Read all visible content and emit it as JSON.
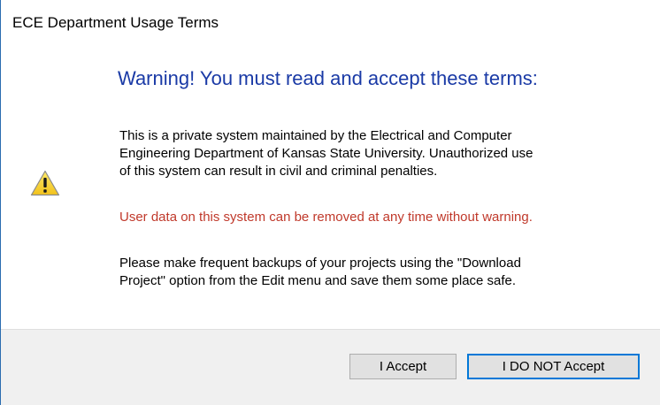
{
  "window": {
    "title": "ECE Department Usage Terms"
  },
  "dialog": {
    "heading": "Warning! You must read and accept these terms:",
    "icon": "warning-icon",
    "paragraph1_lines": [
      "This is a private system maintained by the Electrical and Computer",
      "Engineering Department of Kansas State University. Unauthorized use",
      "of this system can result in civil and criminal penalties."
    ],
    "warning_text": "User data on this system can be removed at any time without warning.",
    "paragraph3_lines": [
      "Please make frequent backups of your projects using the \"Download",
      "Project\" option from the Edit menu and save them some place safe."
    ]
  },
  "buttons": {
    "accept_label": "I Accept",
    "decline_label": "I DO NOT Accept"
  },
  "colors": {
    "heading": "#1a3aa6",
    "warning_text": "#c0392b",
    "focus_border": "#0078d7"
  }
}
